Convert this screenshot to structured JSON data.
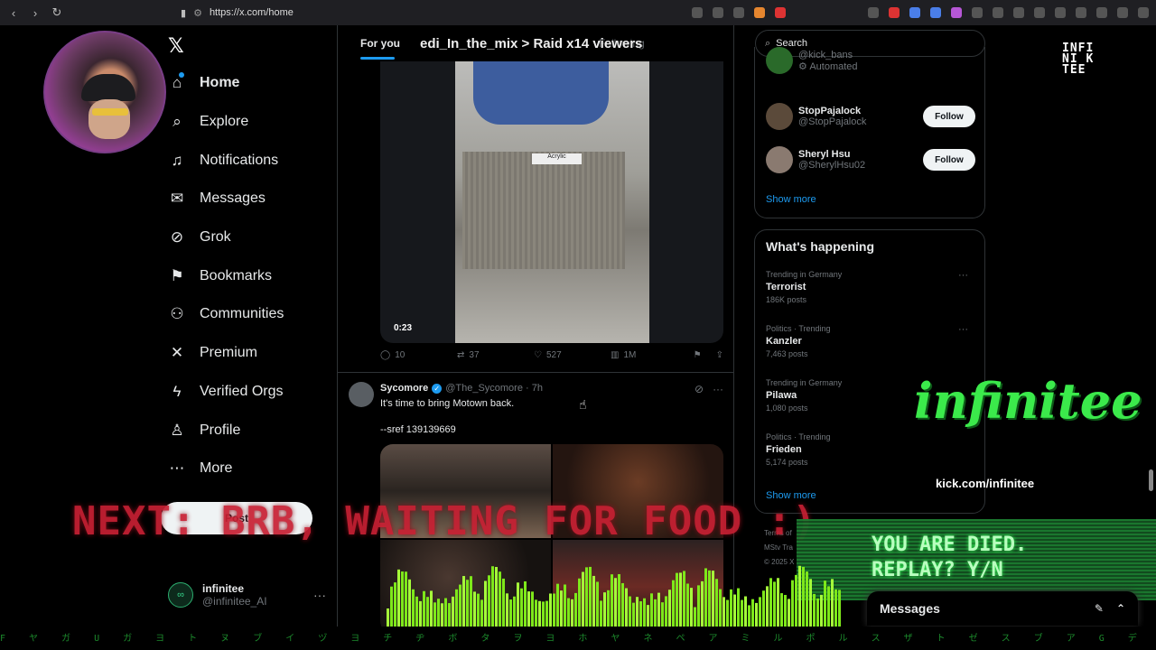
{
  "browser": {
    "url": "https://x.com/home"
  },
  "sidebar": {
    "items": [
      {
        "label": "Home",
        "icon": "home-icon",
        "glyph": "⌂"
      },
      {
        "label": "Explore",
        "icon": "search-icon",
        "glyph": "⌕"
      },
      {
        "label": "Notifications",
        "icon": "bell-icon",
        "glyph": "♫"
      },
      {
        "label": "Messages",
        "icon": "mail-icon",
        "glyph": "✉"
      },
      {
        "label": "Grok",
        "icon": "grok-icon",
        "glyph": "⊘"
      },
      {
        "label": "Bookmarks",
        "icon": "bookmark-icon",
        "glyph": "⚑"
      },
      {
        "label": "Communities",
        "icon": "communities-icon",
        "glyph": "⚇"
      },
      {
        "label": "Premium",
        "icon": "x-icon",
        "glyph": "✕"
      },
      {
        "label": "Verified Orgs",
        "icon": "lightning-icon",
        "glyph": "ϟ"
      },
      {
        "label": "Profile",
        "icon": "person-icon",
        "glyph": "♙"
      },
      {
        "label": "More",
        "icon": "more-circle-icon",
        "glyph": "⋯"
      }
    ],
    "post_label": "Post",
    "account": {
      "name": "infinitee",
      "handle": "@infinitee_AI"
    }
  },
  "timeline": {
    "tabs": [
      {
        "label": "For you"
      },
      {
        "label": "Following"
      }
    ],
    "video_time": "0:23",
    "first_post_actions": {
      "replies": "10",
      "reposts": "37",
      "likes": "527",
      "views": "1M"
    },
    "tweet": {
      "author": "Sycomore",
      "handle": "@The_Sycomore · 7h",
      "text": "It's time to bring Motown back.",
      "text2": "--sref 139139669"
    }
  },
  "right": {
    "search_placeholder": "Search",
    "who_to_follow": [
      {
        "name": "",
        "handle": "@kick_bans",
        "sub": "Automated"
      },
      {
        "name": "StopPajalock",
        "handle": "@StopPajalock",
        "button": "Follow"
      },
      {
        "name": "Sheryl Hsu",
        "handle": "@SherylHsu02",
        "button": "Follow"
      }
    ],
    "show_more": "Show more",
    "happening_title": "What's happening",
    "trends": [
      {
        "context": "Trending in Germany",
        "title": "Terrorist",
        "count": "186K posts"
      },
      {
        "context": "Politics · Trending",
        "title": "Kanzler",
        "count": "7,463 posts"
      },
      {
        "context": "Trending in Germany",
        "title": "Pilawa",
        "count": "1,080 posts"
      },
      {
        "context": "Politics · Trending",
        "title": "Frieden",
        "count": "5,174 posts"
      }
    ],
    "show_more_trends": "Show more",
    "footer": [
      "Terms of",
      "MStv Tra",
      "© 2025 X"
    ]
  },
  "overlay": {
    "raid_text": "edi_In_the_mix > Raid x14 viewers",
    "logo_lines": [
      "INFI",
      "NI K",
      "TEE"
    ],
    "brand": "infinitee",
    "kick": "kick.com/infinitee",
    "next_banner": "NEXT: BRB, WAITING FOR FOOD :)",
    "died_line1": "YOU ARE DIED.",
    "died_line2": "REPLAY? Y/N",
    "messages_label": "Messages",
    "matrix": "F ヤ ガ U ガ ヨ ト ヌ ブ イ ヅ ヨ チ ヂ ボ タ ヲ ヨ ホ ヤ ネ ペ ア ミ ル ポ ル ス ザ ト ゼ ス ブ ア G デ ヨ ブ"
  }
}
